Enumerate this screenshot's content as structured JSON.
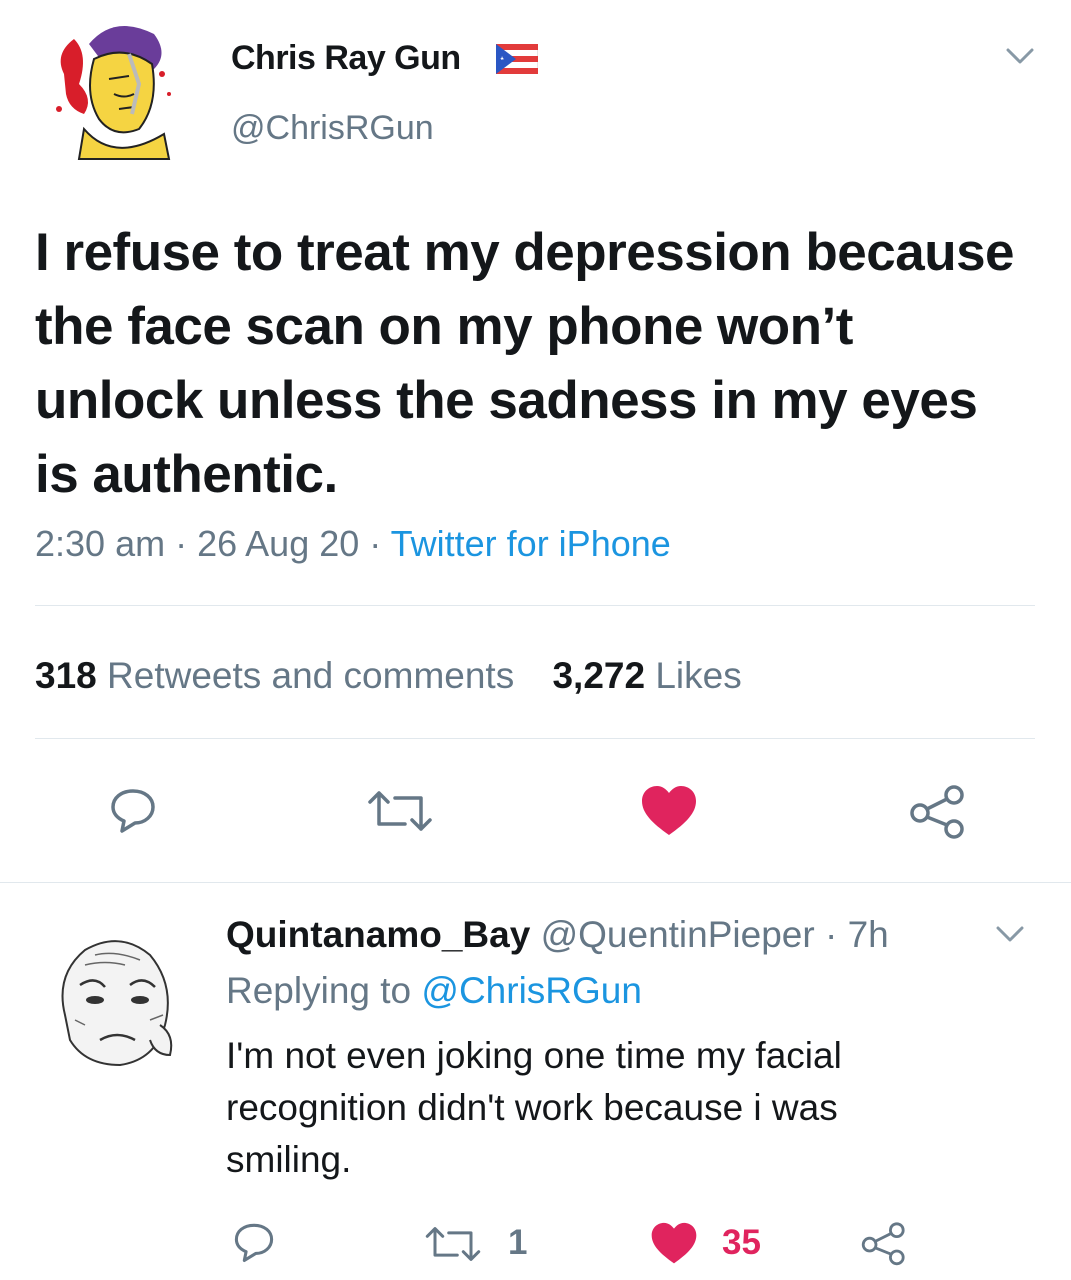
{
  "main_tweet": {
    "author": {
      "display_name": "Chris Ray Gun",
      "handle": "@ChrisRGun",
      "avatar_icon": "cartoon-face-avatar",
      "flag_icon": "puerto-rico-flag-icon"
    },
    "text": "I refuse to treat my depression because the face scan on my phone won’t unlock unless the sadness in my eyes is authentic.",
    "time": "2:30 am",
    "date": "26 Aug 20",
    "source": "Twitter for iPhone",
    "sep": "·",
    "retweets_count": "318",
    "retweets_label": "Retweets and comments",
    "likes_count": "3,272",
    "likes_label": "Likes",
    "menu_icon": "chevron-down-icon",
    "actions": [
      "reply-icon",
      "retweet-icon",
      "heart-icon",
      "share-icon"
    ],
    "liked": true
  },
  "reply_tweet": {
    "author": {
      "display_name": "Quintanamo_Bay",
      "handle": "@QuentinPieper",
      "avatar_icon": "sad-wojak-avatar"
    },
    "time_ago": "· 7h",
    "replying_prefix": "Replying to",
    "replying_to": "@ChrisRGun",
    "text": "I'm not even joking one time my facial recognition didn't work because i was smiling.",
    "retweet_count": "1",
    "like_count": "35",
    "menu_icon": "chevron-down-icon",
    "actions": [
      "reply-icon",
      "retweet-icon",
      "heart-icon",
      "share-icon"
    ],
    "liked": true
  },
  "colors": {
    "text": "#14171a",
    "secondary": "#657786",
    "link": "#1b95e0",
    "like": "#e0245e",
    "divider": "#e1e8ed"
  }
}
